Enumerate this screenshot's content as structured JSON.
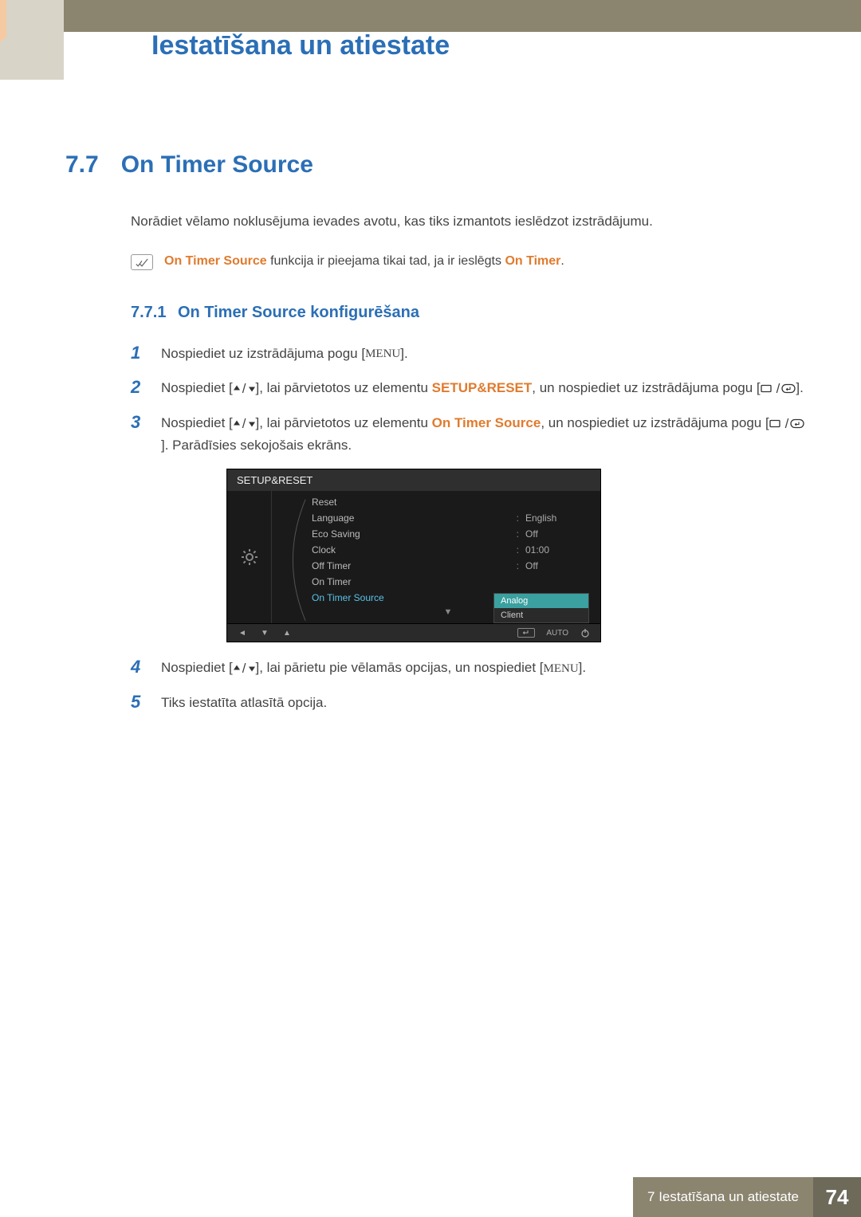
{
  "header": {
    "chapter_title": "Iestatīšana un atiestate"
  },
  "section": {
    "number": "7.7",
    "title": "On Timer Source",
    "intro": "Norādiet vēlamo noklusējuma ievades avotu, kas tiks izmantots ieslēdzot izstrādājumu.",
    "note": {
      "prefix": "On Timer Source",
      "mid": " funkcija ir pieejama tikai tad, ja ir ieslēgts ",
      "suffix": "On Timer",
      "end": "."
    },
    "subsection": {
      "number": "7.7.1",
      "title": "On Timer Source konfigurēšana"
    },
    "steps": {
      "s1": {
        "num": "1",
        "a": "Nospiediet uz izstrādājuma pogu [",
        "menu": "MENU",
        "b": "]."
      },
      "s2": {
        "num": "2",
        "a": "Nospiediet [",
        "b": "], lai pārvietotos uz elementu ",
        "hl": "SETUP&RESET",
        "c": ", un nospiediet uz izstrādājuma pogu [",
        "d": "]."
      },
      "s3": {
        "num": "3",
        "a": "Nospiediet [",
        "b": "], lai pārvietotos uz elementu ",
        "hl": "On Timer Source",
        "c": ", un nospiediet uz izstrādājuma pogu [",
        "d": "]. Parādīsies sekojošais ekrāns."
      },
      "s4": {
        "num": "4",
        "a": "Nospiediet [",
        "b": "], lai pārietu pie vēlamās opcijas, un nospiediet [",
        "menu": "MENU",
        "c": "]."
      },
      "s5": {
        "num": "5",
        "a": "Tiks iestatīta atlasītā opcija."
      }
    }
  },
  "osd": {
    "title": "SETUP&RESET",
    "rows": [
      {
        "label": "Reset",
        "value": ""
      },
      {
        "label": "Language",
        "value": "English"
      },
      {
        "label": "Eco Saving",
        "value": "Off"
      },
      {
        "label": "Clock",
        "value": "01:00"
      },
      {
        "label": "Off Timer",
        "value": "Off"
      },
      {
        "label": "On Timer",
        "value": ""
      },
      {
        "label": "On Timer Source",
        "value": "",
        "selected": true
      }
    ],
    "dropdown": {
      "options": [
        {
          "label": "Analog",
          "selected": true
        },
        {
          "label": "Client",
          "selected": false
        }
      ]
    },
    "footer_auto": "AUTO"
  },
  "footer": {
    "text": "7 Iestatīšana un atiestate",
    "page": "74"
  }
}
